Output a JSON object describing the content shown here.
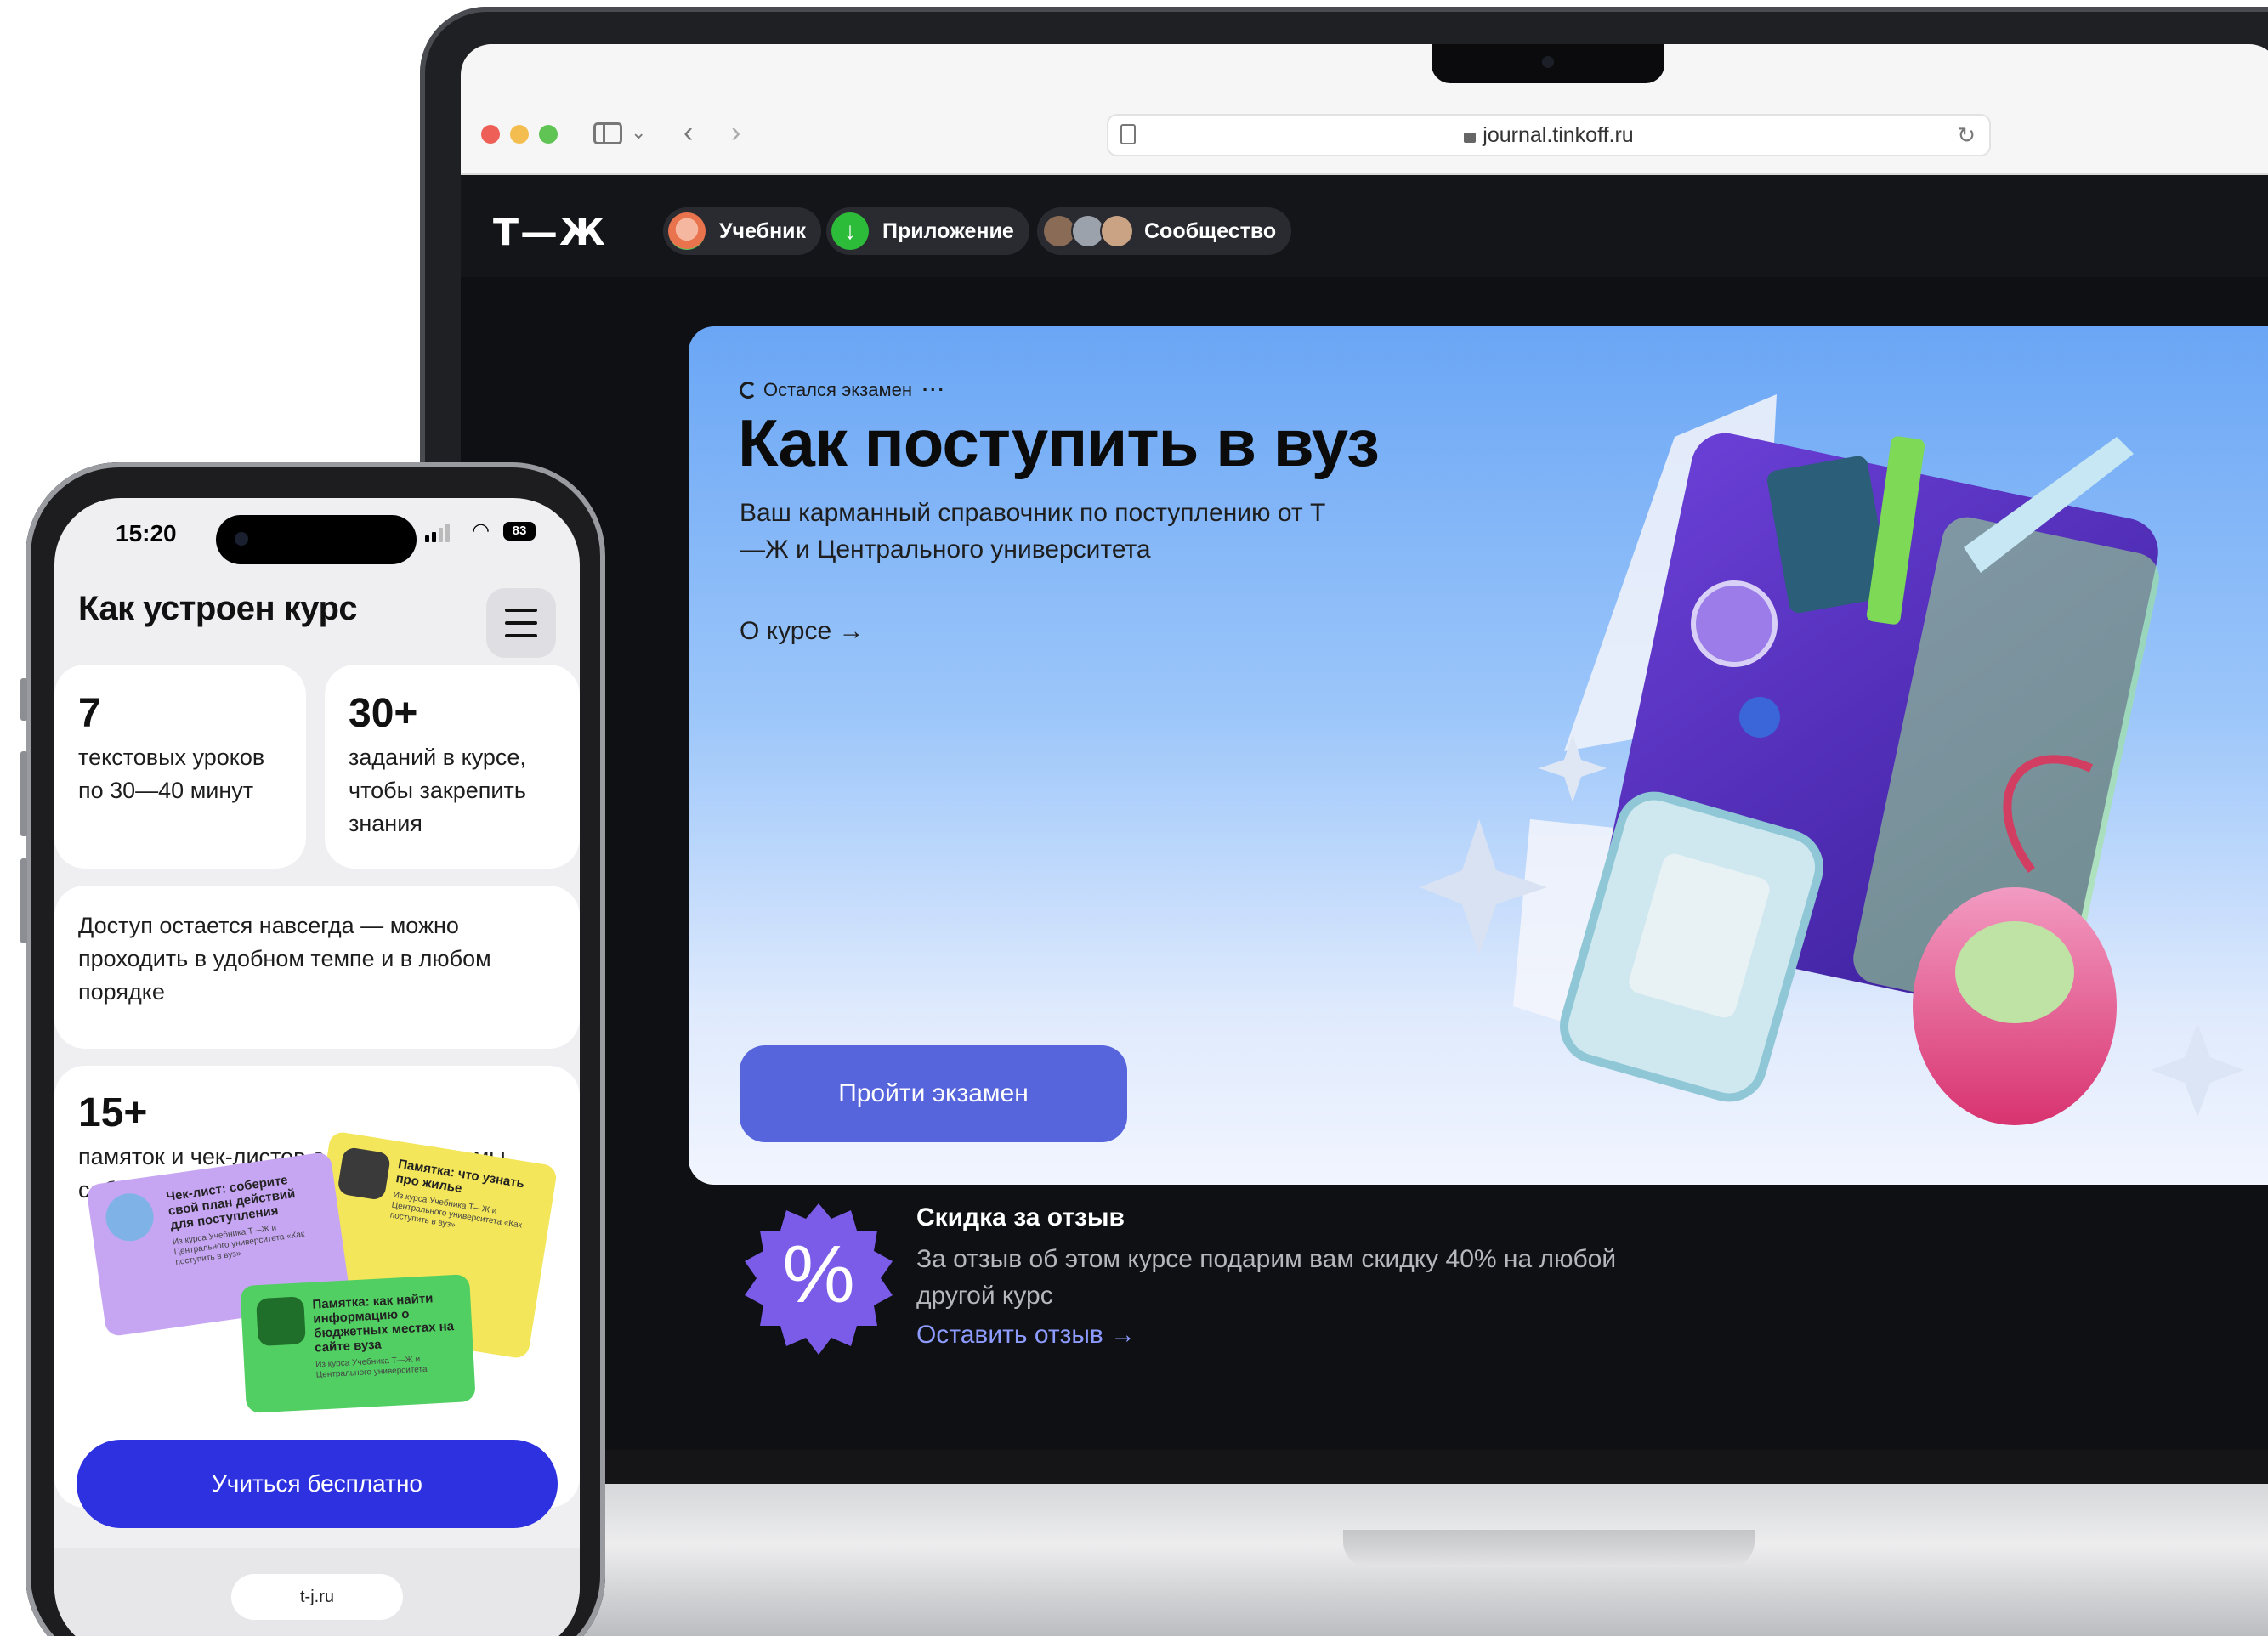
{
  "browser": {
    "url": "journal.tinkoff.ru"
  },
  "site": {
    "logo": "Т—Ж",
    "nav": [
      {
        "label": "Учебник",
        "icon": "textbook-avatar-icon"
      },
      {
        "label": "Приложение",
        "icon": "download-arrow-icon"
      },
      {
        "label": "Сообщество",
        "icon": "community-avatars-icon"
      }
    ],
    "hero": {
      "kicker": "Остался экзамен",
      "kicker_more": "···",
      "title": "Как поступить в вуз",
      "subtitle": "Ваш карманный справочник по поступлению от Т—Ж и Центрального университета",
      "about_link": "О курсе →",
      "cta": "Пройти экзамен"
    },
    "promo": {
      "badge_symbol": "%",
      "title": "Скидка за отзыв",
      "text": "За отзыв об этом курсе подарим вам скидку 40% на любой другой курс",
      "link": "Оставить отзыв →"
    }
  },
  "phone": {
    "status": {
      "time": "15:20",
      "battery": "83"
    },
    "title": "Как устроен курс",
    "cards": [
      {
        "big": "7",
        "text": "текстовых уроков по 30—40 минут"
      },
      {
        "big": "30+",
        "text": "заданий в курсе, чтобы закрепить знания"
      },
      {
        "text": "Доступ остается навсегда — можно проходить в удобном темпе и в любом порядке"
      },
      {
        "big": "15+",
        "text": "памяток и чек-листов о поступлении мы собрали в уроках"
      }
    ],
    "memos": [
      {
        "title": "Памятка: что узнать про жилье",
        "sub": "Из курса Учебника Т—Ж и Центрального университета «Как поступить в вуз»"
      },
      {
        "title": "Чек-лист: соберите свой план действий для поступления",
        "sub": "Из курса Учебника Т—Ж и Центрального университета «Как поступить в вуз»"
      },
      {
        "title": "Памятка: как найти информацию о бюджетных местах на сайте вуза",
        "sub": "Из курса Учебника Т—Ж и Центрального университета"
      }
    ],
    "cta": "Учиться бесплатно",
    "url": "t-j.ru"
  },
  "colors": {
    "hero_button": "#5765dc",
    "phone_button": "#2d31e0",
    "promo_badge": "#7a5ce8",
    "promo_link": "#8d9bff"
  }
}
